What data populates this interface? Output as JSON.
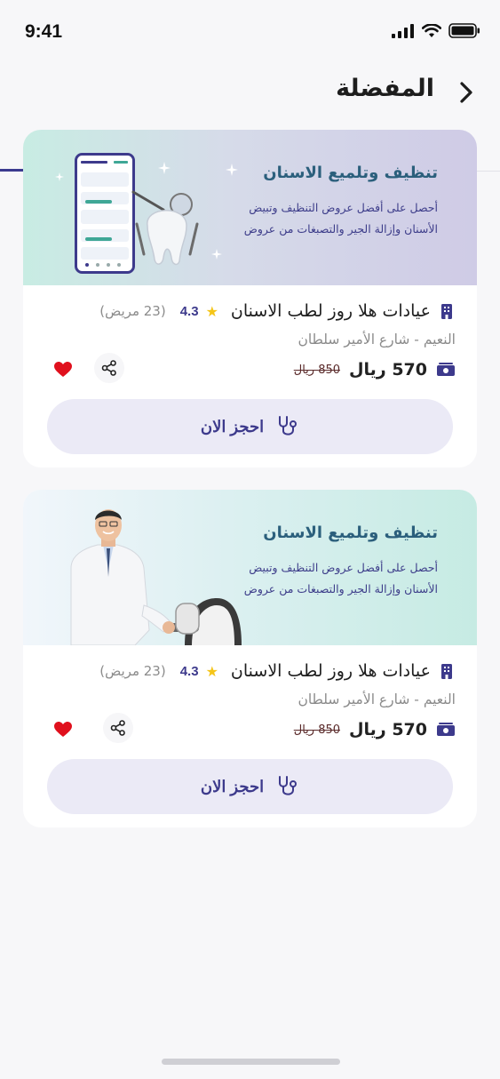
{
  "status_bar": {
    "time": "9:41"
  },
  "header": {
    "title": "المفضلة"
  },
  "offers": [
    {
      "banner_title": "تنظيف وتلميع الاسنان",
      "banner_text": "أحصل على أفضل عروض التنظيف وتبيض الأسنان وإزالة الجير والتصبغات من عروض",
      "clinic_name": "عيادات هلا روز لطب الاسنان",
      "rating": "4.3",
      "reviews": "(23 مريض)",
      "address": "النعيم - شارع الأمير سلطان",
      "price": "570 ريال",
      "old_price": "850 ريال",
      "book_label": "احجز الان"
    },
    {
      "banner_title": "تنظيف وتلميع الاسنان",
      "banner_text": "أحصل على أفضل عروض التنظيف وتبيض الأسنان وإزالة الجير والتصبغات من عروض",
      "clinic_name": "عيادات هلا روز لطب الاسنان",
      "rating": "4.3",
      "reviews": "(23 مريض)",
      "address": "النعيم - شارع الأمير سلطان",
      "price": "570 ريال",
      "old_price": "850 ريال",
      "book_label": "احجز الان"
    }
  ],
  "icons": {
    "back": "chevron-right-icon",
    "clinic": "building-icon",
    "rating": "star-icon",
    "price": "money-icon",
    "share": "share-icon",
    "favorite": "heart-icon",
    "book": "stethoscope-icon"
  },
  "colors": {
    "primary": "#3d3a8c",
    "favorite": "#e0101d",
    "star": "#f5c518",
    "banner_title": "#2b5f7c"
  }
}
